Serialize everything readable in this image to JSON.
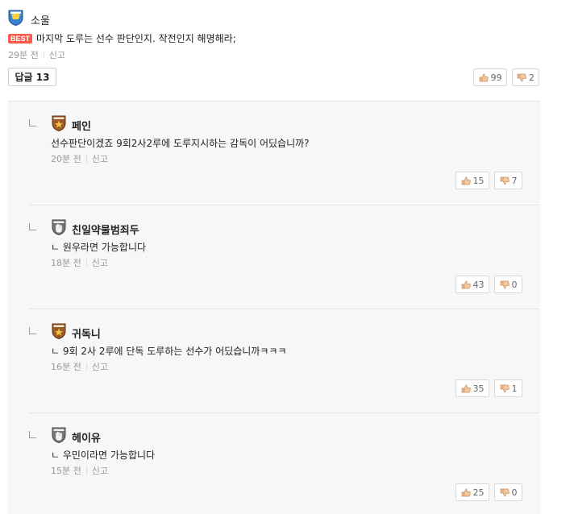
{
  "main_comment": {
    "author": "소울",
    "best_label": "BEST",
    "text": "마지막 도루는 선수 판단인지. 작전인지 해명해라;",
    "time": "29분 전",
    "report": "신고",
    "likes": "99",
    "dislikes": "2"
  },
  "replies_toggle": {
    "label": "답글",
    "count": "13"
  },
  "replies": [
    {
      "author": "페인",
      "text": "선수판단이겠죠 9회2사2루에 도루지시하는 감독이 어딨습니까?",
      "time": "20분 전",
      "report": "신고",
      "likes": "15",
      "dislikes": "7",
      "badge": "star-brown"
    },
    {
      "author": "친일약물범죄두",
      "text": "ㄴ 원우라면 가능합니다",
      "time": "18분 전",
      "report": "신고",
      "likes": "43",
      "dislikes": "0",
      "badge": "hand-gray"
    },
    {
      "author": "귀독니",
      "text": "ㄴ 9회 2사 2루에 단독 도루하는 선수가 어딨습니까ㅋㅋㅋ",
      "time": "16분 전",
      "report": "신고",
      "likes": "35",
      "dislikes": "1",
      "badge": "star-brown"
    },
    {
      "author": "헤이유",
      "text": "ㄴ 우민이라면 가능합니다",
      "time": "15분 전",
      "report": "신고",
      "likes": "25",
      "dislikes": "0",
      "badge": "hand-gray"
    }
  ],
  "colors": {
    "best": "#ff5a4a",
    "reply_bg": "#f7f7f7",
    "badge_blue": "#3a7fd0",
    "badge_brown": "#9a5a2a",
    "badge_gray": "#777777"
  }
}
